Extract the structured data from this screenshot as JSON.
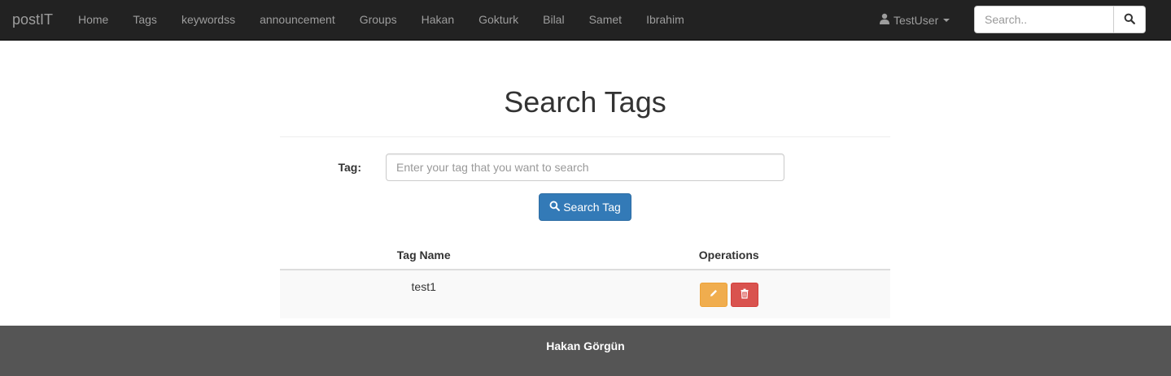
{
  "navbar": {
    "brand": "postIT",
    "items": [
      {
        "label": "Home"
      },
      {
        "label": "Tags"
      },
      {
        "label": "keywordss"
      },
      {
        "label": "announcement"
      },
      {
        "label": "Groups"
      },
      {
        "label": "Hakan"
      },
      {
        "label": "Gokturk"
      },
      {
        "label": "Bilal"
      },
      {
        "label": "Samet"
      },
      {
        "label": "Ibrahim"
      }
    ],
    "user": {
      "label": "TestUser",
      "icon": "user-icon"
    },
    "search": {
      "placeholder": "Search..",
      "icon": "search-icon"
    }
  },
  "main": {
    "title": "Search Tags",
    "tag_label": "Tag:",
    "tag_placeholder": "Enter your tag that you want to search",
    "search_button": "Search Tag"
  },
  "table": {
    "headers": [
      "Tag Name",
      "Operations"
    ],
    "rows": [
      {
        "name": "test1",
        "operations": [
          "edit",
          "delete"
        ]
      }
    ]
  },
  "footer": {
    "text": "Hakan Görgün"
  },
  "colors": {
    "navbar_bg": "#222222",
    "primary": "#337ab7",
    "warning": "#f0ad4e",
    "danger": "#d9534f",
    "footer_bg": "#555555"
  }
}
